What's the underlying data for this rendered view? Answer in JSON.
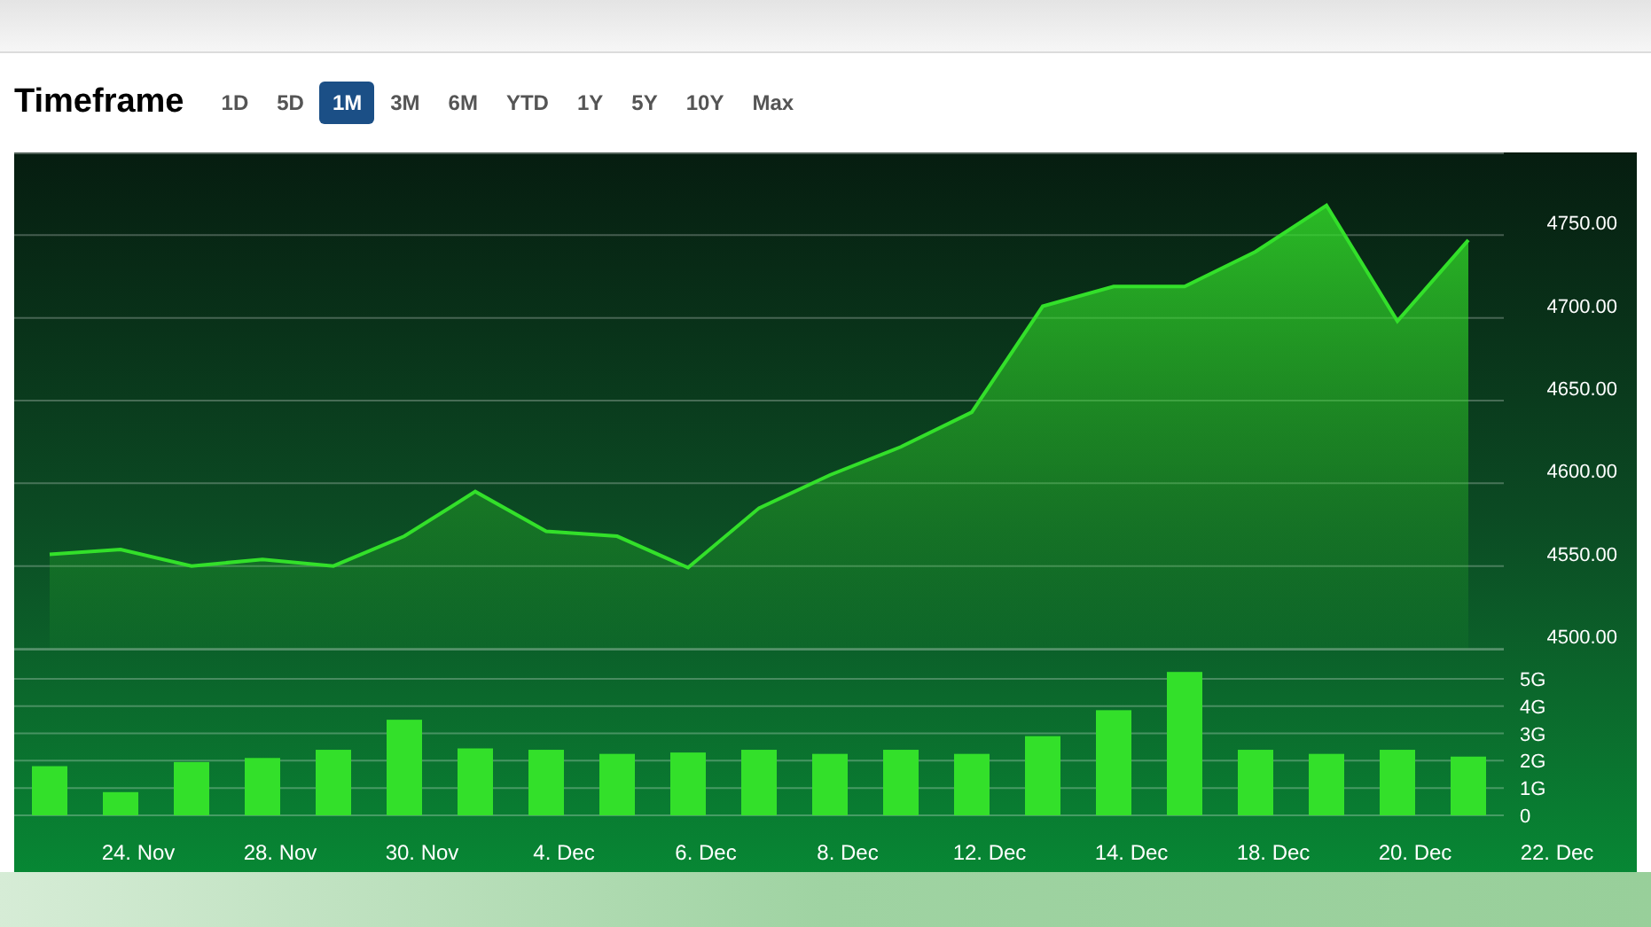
{
  "heading": "Timeframe",
  "timeframes": [
    {
      "label": "1D",
      "selected": false
    },
    {
      "label": "5D",
      "selected": false
    },
    {
      "label": "1M",
      "selected": true
    },
    {
      "label": "3M",
      "selected": false
    },
    {
      "label": "6M",
      "selected": false
    },
    {
      "label": "YTD",
      "selected": false
    },
    {
      "label": "1Y",
      "selected": false
    },
    {
      "label": "5Y",
      "selected": false
    },
    {
      "label": "10Y",
      "selected": false
    },
    {
      "label": "Max",
      "selected": false
    }
  ],
  "price_chart": {
    "chart_data": {
      "type": "area",
      "grid": true,
      "ylim": [
        4500,
        4800
      ],
      "series": [
        {
          "color": "#33e02a",
          "values": [
            4557,
            4560,
            4550,
            4554,
            4550,
            4568,
            4595,
            4571,
            4568,
            4549,
            4585,
            4605,
            4622,
            4643,
            4707,
            4719,
            4719,
            4740,
            4768,
            4698,
            4747
          ]
        }
      ],
      "yticks": [
        {
          "value": 4500,
          "label": "4500.00"
        },
        {
          "value": 4550,
          "label": "4550.00"
        },
        {
          "value": 4600,
          "label": "4600.00"
        },
        {
          "value": 4650,
          "label": "4650.00"
        },
        {
          "value": 4700,
          "label": "4700.00"
        },
        {
          "value": 4750,
          "label": "4750.00"
        }
      ]
    }
  },
  "volume_chart": {
    "chart_data": {
      "type": "bar",
      "grid": true,
      "ylim": [
        0,
        6.1
      ],
      "categories": [
        null,
        "24. Nov",
        null,
        "28. Nov",
        null,
        "30. Nov",
        null,
        "4. Dec",
        null,
        "6. Dec",
        null,
        "8. Dec",
        null,
        "12. Dec",
        null,
        "14. Dec",
        null,
        "18. Dec",
        null,
        "20. Dec",
        null,
        "22. Dec"
      ],
      "series": [
        {
          "color": "#33e02a",
          "values": [
            1.8,
            0.85,
            1.95,
            2.1,
            2.4,
            3.5,
            2.45,
            2.4,
            2.25,
            2.3,
            2.4,
            2.25,
            2.4,
            2.25,
            2.9,
            3.85,
            5.25,
            2.4,
            2.25,
            2.4,
            2.15,
            null
          ]
        }
      ],
      "yticks": [
        {
          "value": 0,
          "label": "0"
        },
        {
          "value": 1,
          "label": "1G"
        },
        {
          "value": 2,
          "label": "2G"
        },
        {
          "value": 3,
          "label": "3G"
        },
        {
          "value": 4,
          "label": "4G"
        },
        {
          "value": 5,
          "label": "5G"
        }
      ]
    }
  }
}
